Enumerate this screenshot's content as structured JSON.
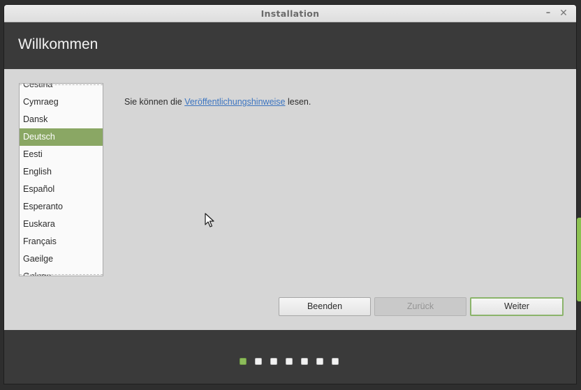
{
  "window": {
    "title": "Installation",
    "minimize_glyph": "–",
    "close_glyph": "✕"
  },
  "header": {
    "title": "Willkommen"
  },
  "language_list": {
    "items": [
      "Čeština",
      "Cymraeg",
      "Dansk",
      "Deutsch",
      "Eesti",
      "English",
      "Español",
      "Esperanto",
      "Euskara",
      "Français",
      "Gaeilge",
      "Galego"
    ],
    "selected": "Deutsch"
  },
  "intro": {
    "before": "Sie können die",
    "link": "Veröffentlichungshinweise",
    "after": "lesen."
  },
  "buttons": {
    "quit": "Beenden",
    "back": "Zurück",
    "next": "Weiter"
  },
  "progress": {
    "current_step": 1,
    "total_steps": 7
  },
  "colors": {
    "accent": "#8aa764",
    "header_bg": "#3a3a3a",
    "link": "#3b74c0"
  },
  "icons": {
    "minimize": "minimize-icon",
    "close": "close-icon",
    "cursor": "mouse-pointer-icon"
  }
}
